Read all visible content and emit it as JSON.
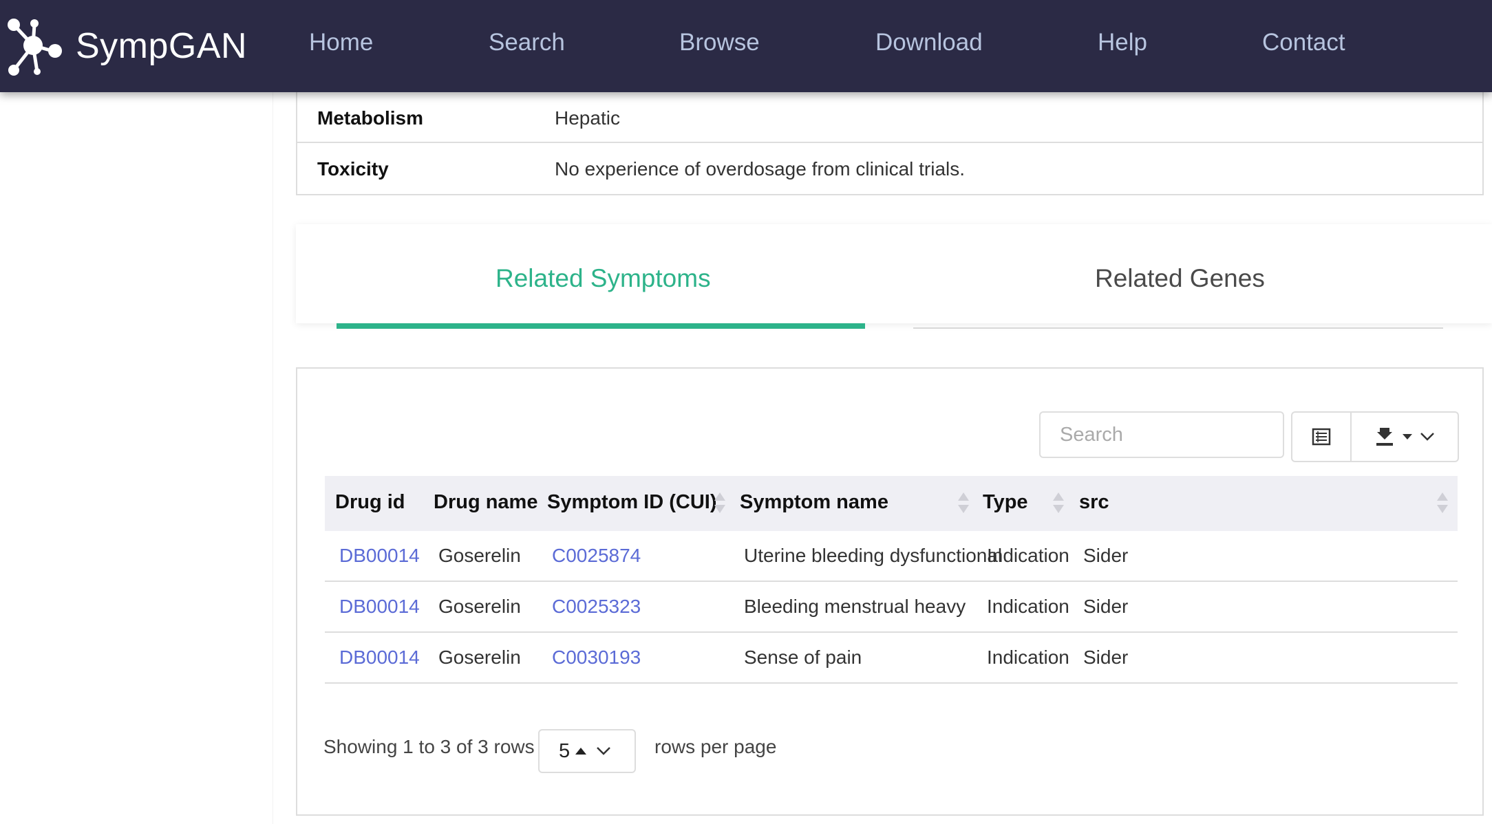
{
  "brand": {
    "name": "SympGAN"
  },
  "nav": [
    {
      "label": "Home"
    },
    {
      "label": "Search"
    },
    {
      "label": "Browse"
    },
    {
      "label": "Download"
    },
    {
      "label": "Help"
    },
    {
      "label": "Contact"
    }
  ],
  "info": [
    {
      "label": "Metabolism",
      "value": "Hepatic"
    },
    {
      "label": "Toxicity",
      "value": "No experience of overdosage from clinical trials."
    }
  ],
  "tabs": [
    {
      "label": "Related Symptoms",
      "active": true
    },
    {
      "label": "Related Genes",
      "active": false
    }
  ],
  "toolbar": {
    "search_placeholder": "Search"
  },
  "table": {
    "columns": [
      "Drug id",
      "Drug name",
      "Symptom ID (CUI)",
      "Symptom name",
      "Type",
      "src"
    ],
    "rows": [
      [
        "DB00014",
        "Goserelin",
        "C0025874",
        "Uterine bleeding dysfunctional",
        "Indication",
        "Sider"
      ],
      [
        "DB00014",
        "Goserelin",
        "C0025323",
        "Bleeding menstrual heavy",
        "Indication",
        "Sider"
      ],
      [
        "DB00014",
        "Goserelin",
        "C0030193",
        "Sense of pain",
        "Indication",
        "Sider"
      ]
    ]
  },
  "pagination": {
    "showing": "Showing 1 to 3 of 3 rows",
    "page_size": "5",
    "rows_per_page": "rows per page"
  },
  "colors": {
    "navbar": "#2b2a45",
    "accent": "#2db38a",
    "link": "#5b6bd6"
  }
}
